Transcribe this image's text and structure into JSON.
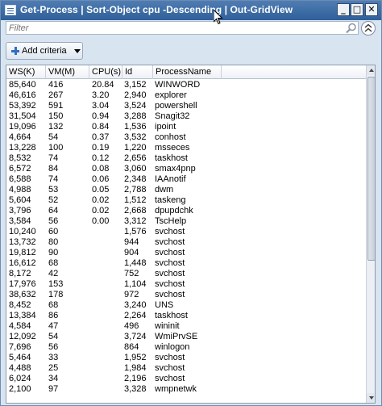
{
  "window": {
    "title": "Get-Process | Sort-Object cpu -Descending | Out-GridView",
    "controls": {
      "minimize": "_",
      "maximize": "□",
      "close": "✕"
    }
  },
  "filter": {
    "placeholder": "Filter",
    "value": ""
  },
  "toolbar": {
    "add_criteria_label": "Add criteria"
  },
  "grid": {
    "columns": [
      "WS(K)",
      "VM(M)",
      "CPU(s)",
      "Id",
      "ProcessName"
    ],
    "rows": [
      [
        "85,640",
        "416",
        "20.84",
        "3,152",
        "WINWORD"
      ],
      [
        "46,616",
        "267",
        "3.20",
        "2,940",
        "explorer"
      ],
      [
        "53,392",
        "591",
        "3.04",
        "3,524",
        "powershell"
      ],
      [
        "31,504",
        "150",
        "0.94",
        "3,288",
        "Snagit32"
      ],
      [
        "19,096",
        "132",
        "0.84",
        "1,536",
        "ipoint"
      ],
      [
        "4,664",
        "54",
        "0.37",
        "3,532",
        "conhost"
      ],
      [
        "13,228",
        "100",
        "0.19",
        "1,220",
        "msseces"
      ],
      [
        "8,532",
        "74",
        "0.12",
        "2,656",
        "taskhost"
      ],
      [
        "6,572",
        "84",
        "0.08",
        "3,060",
        "smax4pnp"
      ],
      [
        "6,588",
        "74",
        "0.06",
        "2,348",
        "IAAnotif"
      ],
      [
        "4,988",
        "53",
        "0.05",
        "2,788",
        "dwm"
      ],
      [
        "5,604",
        "52",
        "0.02",
        "1,512",
        "taskeng"
      ],
      [
        "3,796",
        "64",
        "0.02",
        "2,668",
        "dpupdchk"
      ],
      [
        "3,584",
        "56",
        "0.00",
        "3,312",
        "TscHelp"
      ],
      [
        "10,240",
        "60",
        "",
        "1,576",
        "svchost"
      ],
      [
        "13,732",
        "80",
        "",
        "944",
        "svchost"
      ],
      [
        "19,812",
        "90",
        "",
        "904",
        "svchost"
      ],
      [
        "16,612",
        "68",
        "",
        "1,448",
        "svchost"
      ],
      [
        "8,172",
        "42",
        "",
        "752",
        "svchost"
      ],
      [
        "17,976",
        "153",
        "",
        "1,104",
        "svchost"
      ],
      [
        "38,632",
        "178",
        "",
        "972",
        "svchost"
      ],
      [
        "8,452",
        "68",
        "",
        "3,240",
        "UNS"
      ],
      [
        "13,384",
        "86",
        "",
        "2,264",
        "taskhost"
      ],
      [
        "4,584",
        "47",
        "",
        "496",
        "wininit"
      ],
      [
        "12,092",
        "54",
        "",
        "3,724",
        "WmiPrvSE"
      ],
      [
        "7,696",
        "56",
        "",
        "864",
        "winlogon"
      ],
      [
        "5,464",
        "33",
        "",
        "1,952",
        "svchost"
      ],
      [
        "4,488",
        "25",
        "",
        "1,984",
        "svchost"
      ],
      [
        "6,024",
        "34",
        "",
        "2,196",
        "svchost"
      ],
      [
        "2,100",
        "97",
        "",
        "3,328",
        "wmpnetwk"
      ]
    ]
  },
  "colors": {
    "titlebar": "#3a6aa6",
    "window_bg": "#d8e4f0",
    "accent": "#2f6fc0"
  },
  "icons": [
    "window-icon",
    "search-icon",
    "collapse-icon",
    "add-icon",
    "dropdown-caret-icon",
    "mouse-cursor-icon"
  ]
}
